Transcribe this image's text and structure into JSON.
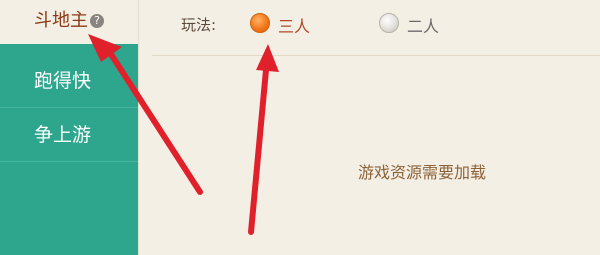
{
  "sidebar": {
    "items": [
      {
        "label": "斗地主",
        "active": true,
        "has_help_icon": true
      },
      {
        "label": "跑得快",
        "active": false
      },
      {
        "label": "争上游",
        "active": false
      }
    ]
  },
  "play_mode": {
    "label": "玩法:",
    "options": [
      {
        "label": "三人",
        "selected": true
      },
      {
        "label": "二人",
        "selected": false
      }
    ]
  },
  "status": {
    "message": "游戏资源需要加载"
  },
  "colors": {
    "sidebar": "#2ea58d",
    "page": "#f4efe4",
    "active_text": "#8b3a16",
    "selected_radio": "#f2781b",
    "annotation_arrow": "#e0212b"
  }
}
